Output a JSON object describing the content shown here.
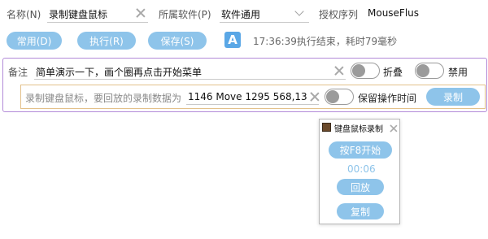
{
  "fields": {
    "name_label": "名称(N)",
    "name_value": "录制键盘鼠标",
    "software_label": "所属软件(P)",
    "software_value": "软件通用",
    "license_label": "授权序列",
    "license_value": "MouseFlus"
  },
  "toolbar": {
    "common_label": "常用(D)",
    "execute_label": "执行(R)",
    "save_label": "保存(S)",
    "font_icon_glyph": "A",
    "status_text": "17:36:39执行结束，耗时79毫秒"
  },
  "note": {
    "label": "备注",
    "value": "简单演示一下，画个圈再点击开始菜单",
    "fold_label": "折叠",
    "disable_label": "禁用"
  },
  "record": {
    "prompt": "录制键盘鼠标，要回放的录制数据为",
    "value": "1146 Move 1295 568,13 Mo",
    "keep_time_label": "保留操作时间",
    "record_button_label": "录制"
  },
  "popup": {
    "title": "键盘鼠标录制",
    "start_label": "按F8开始",
    "timer": "00:06",
    "replay_label": "回放",
    "copy_label": "复制"
  },
  "colors": {
    "accent": "#8ec4ea",
    "group_border": "#b28ad8",
    "inner_border": "#e3c18b"
  }
}
